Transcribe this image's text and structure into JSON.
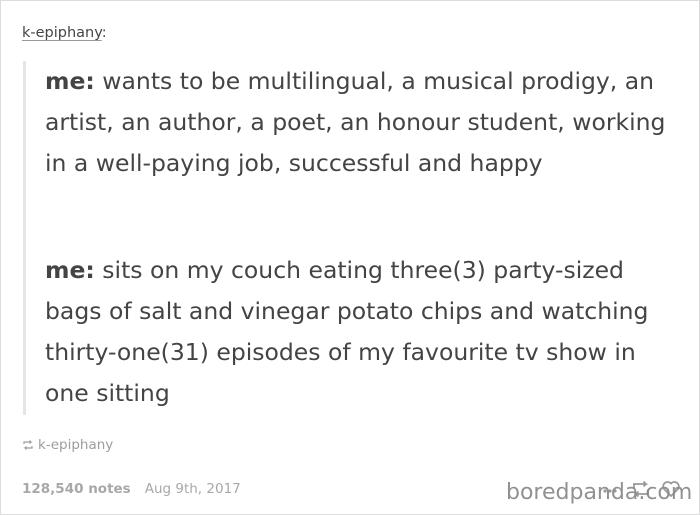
{
  "post": {
    "username": "k-epiphany",
    "colon": ":",
    "paragraphs": [
      {
        "speaker": "me:",
        "text": " wants to be multilingual, a musical prodigy, an artist, an author, a poet, an honour student, working in a well-paying job, successful and happy"
      },
      {
        "speaker": "me:",
        "text": " sits on my couch eating three(3) party-sized bags of salt and vinegar potato chips and watching thirty-one(31) episodes of my favourite tv show in one sitting"
      }
    ],
    "source": "k-epiphany"
  },
  "footer": {
    "notes": "128,540 notes",
    "date": "Aug 9th, 2017"
  },
  "actions": {
    "icons": [
      "share-icon",
      "reblog-icon",
      "like-icon"
    ]
  },
  "watermark": "boredpanda.com",
  "colors": {
    "text": "#444444",
    "muted": "#a8a8a8",
    "quote_border": "#e5e5e5"
  }
}
